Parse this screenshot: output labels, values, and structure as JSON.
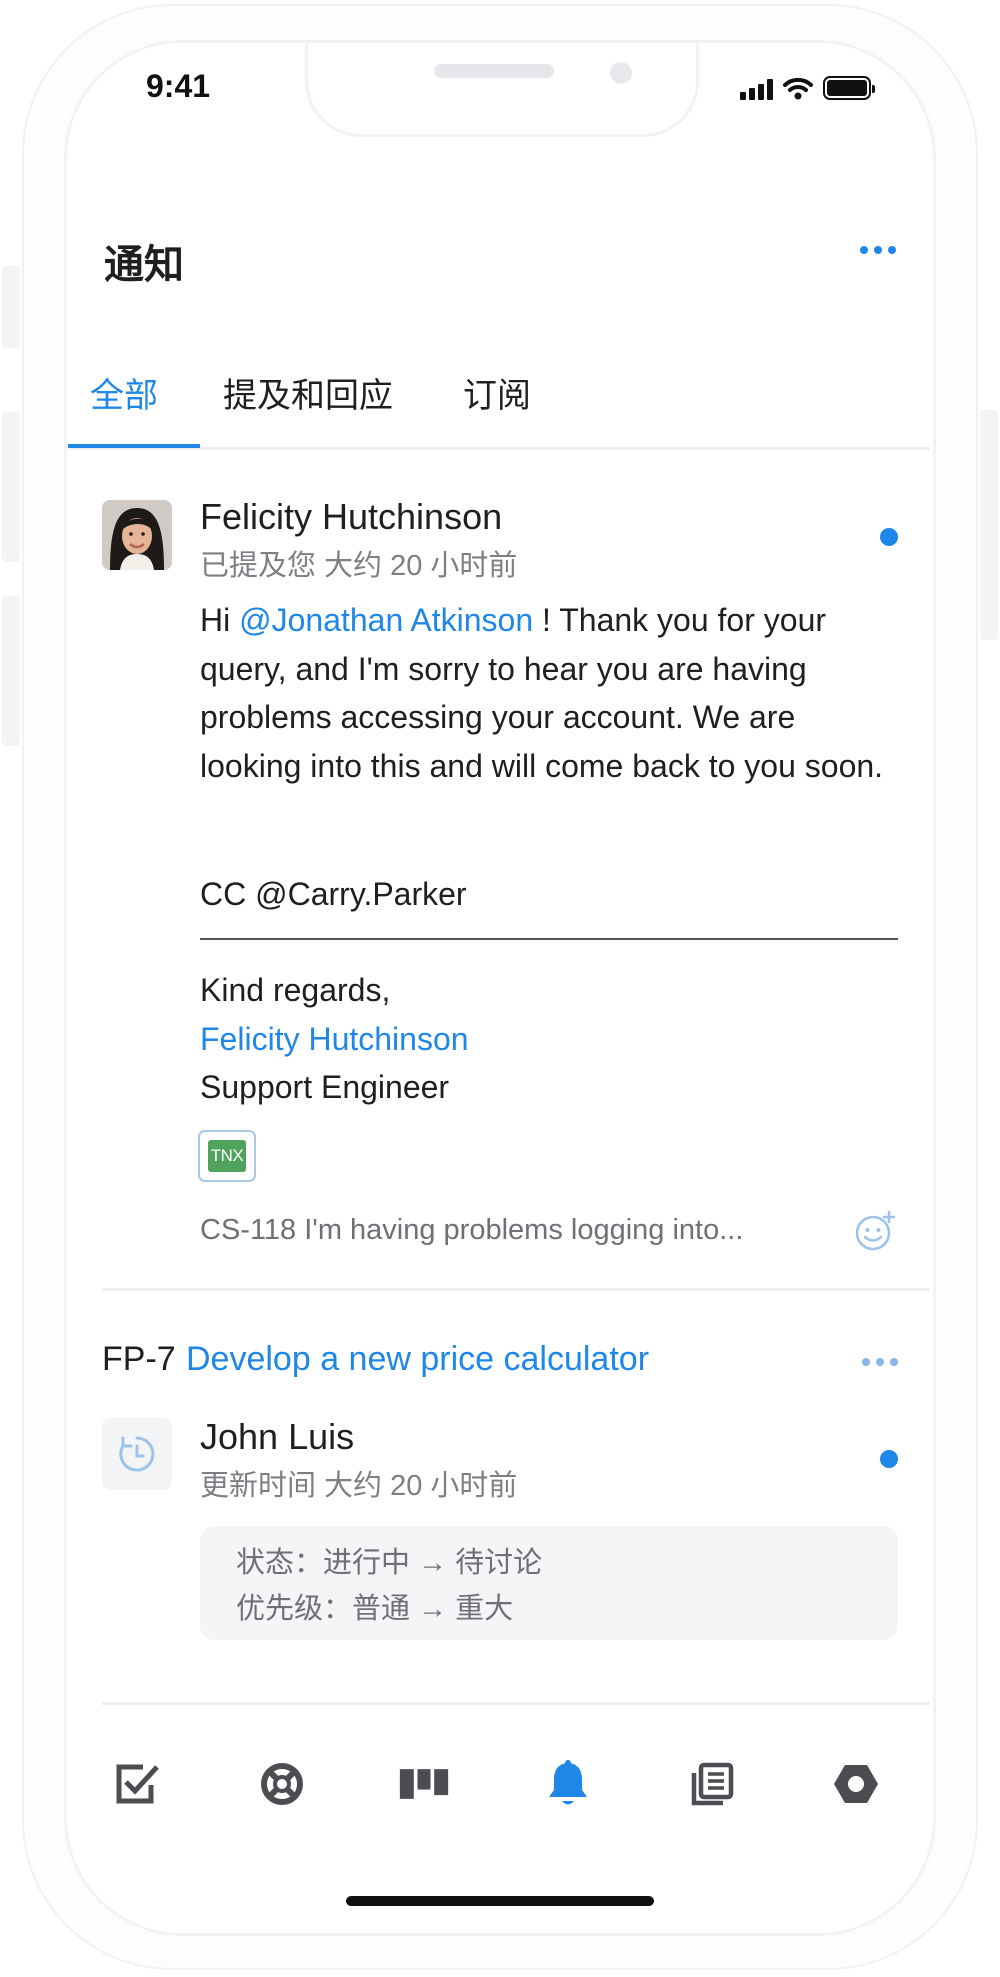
{
  "status_bar": {
    "time": "9:41"
  },
  "header": {
    "title": "通知",
    "more_icon": "more-horizontal-icon"
  },
  "tabs": [
    {
      "label": "全部",
      "active": true
    },
    {
      "label": "提及和回应",
      "active": false
    },
    {
      "label": "订阅",
      "active": false
    }
  ],
  "mention_notification": {
    "author": "Felicity Hutchinson",
    "meta": "已提及您 大约 20 小时前",
    "unread": true,
    "message": {
      "greeting": "Hi",
      "mention": "@Jonathan Atkinson",
      "text": "! Thank you for your query, and I'm sorry to hear you are having problems accessing your account. We are looking into this and will come back to you soon."
    },
    "cc": "CC @Carry.Parker",
    "signature": {
      "closing": "Kind regards,",
      "name": "Felicity Hutchinson",
      "role": "Support Engineer"
    },
    "attachment_label": "TNX",
    "issue_ref": "CS-118 I'm having problems logging into...",
    "reaction_icon": "add-emoji-icon"
  },
  "update_notification": {
    "issue_key": "FP-7",
    "issue_title": "Develop a new price calculator",
    "author": "John Luis",
    "meta": "更新时间 大约 20 小时前",
    "unread": true,
    "changes": [
      "状态：进行中 → 待讨论",
      "优先级：普通 → 重大"
    ]
  },
  "bottom_nav": [
    {
      "icon": "checkbox-icon",
      "active": false
    },
    {
      "icon": "lifebuoy-icon",
      "active": false
    },
    {
      "icon": "board-icon",
      "active": false
    },
    {
      "icon": "bell-icon",
      "active": true
    },
    {
      "icon": "knowledge-base-icon",
      "active": false
    },
    {
      "icon": "settings-hexagon-icon",
      "active": false
    }
  ],
  "colors": {
    "accent": "#1f87e8",
    "text": "#1f1f1f",
    "muted": "#7d7f84"
  }
}
